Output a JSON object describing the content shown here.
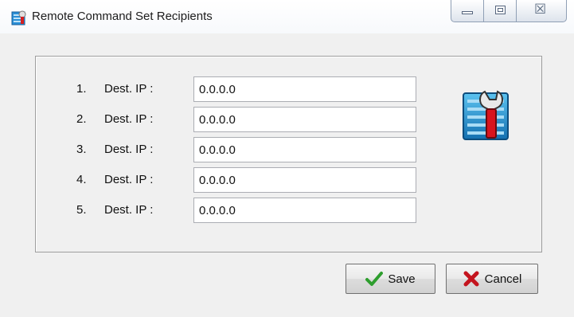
{
  "window": {
    "title": "Remote Command Set Recipients",
    "title_icon": "app-config-icon"
  },
  "caption_buttons": [
    {
      "name": "minimize",
      "icon": "minimize-icon"
    },
    {
      "name": "maximize",
      "icon": "maximize-icon"
    },
    {
      "name": "close",
      "icon": "close-icon",
      "glyph": "☒"
    }
  ],
  "recipients": [
    {
      "number": "1.",
      "label": "Dest. IP :",
      "value": "0.0.0.0"
    },
    {
      "number": "2.",
      "label": "Dest. IP :",
      "value": "0.0.0.0"
    },
    {
      "number": "3.",
      "label": "Dest. IP :",
      "value": "0.0.0.0"
    },
    {
      "number": "4.",
      "label": "Dest. IP :",
      "value": "0.0.0.0"
    },
    {
      "number": "5.",
      "label": "Dest. IP :",
      "value": "0.0.0.0"
    }
  ],
  "decor_icon": "settings-wrench-icon",
  "buttons": {
    "save_label": "Save",
    "save_icon": "checkmark-icon",
    "cancel_label": "Cancel",
    "cancel_icon": "red-x-icon"
  },
  "colors": {
    "check_green": "#2e9e2e",
    "cancel_red": "#c4141e",
    "icon_blue": "#1e8ec8"
  }
}
